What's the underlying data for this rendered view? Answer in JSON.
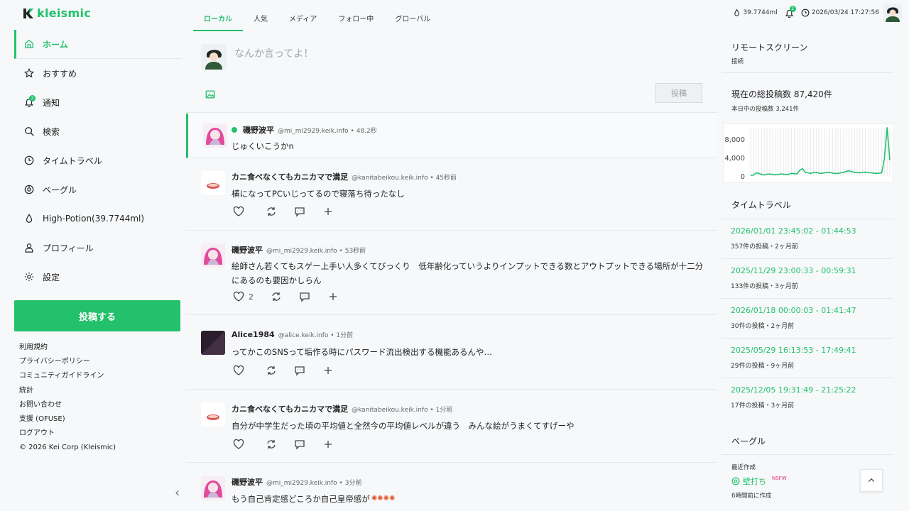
{
  "brand": {
    "logo_mark": "K",
    "name": "kleismic"
  },
  "sidebar": {
    "items": [
      {
        "label": "ホーム"
      },
      {
        "label": "おすすめ"
      },
      {
        "label": "通知",
        "badge": "2"
      },
      {
        "label": "検索"
      },
      {
        "label": "タイムトラベル"
      },
      {
        "label": "ベーグル"
      },
      {
        "label": "High-Potion(39.7744ml)"
      },
      {
        "label": "プロフィール"
      },
      {
        "label": "設定"
      }
    ],
    "post_button": "投稿する",
    "links": [
      "利用規約",
      "プライバシーポリシー",
      "コミュニティガイドライン",
      "統計",
      "お問い合わせ",
      "支援 (OFUSE)",
      "ログアウト",
      "© 2026 Kei Corp (Kleismic)"
    ]
  },
  "tabs": [
    "ローカル",
    "人気",
    "メディア",
    "フォロー中",
    "グローバル"
  ],
  "composer": {
    "placeholder": "なんか言ってよ！",
    "submit": "投稿"
  },
  "posts": [
    {
      "name": "磯野波平",
      "handle": "@mi_mi2929.keik.info • 48.2秒",
      "text": "じゅくいこうかn",
      "online": true
    },
    {
      "name": "カニ食べなくてもカニカマで満足",
      "handle": "@kanitabeikou.keik.info • 45秒前",
      "text": "横になってPCいじってるので寝落ち待ったなし",
      "likes": ""
    },
    {
      "name": "磯野波平",
      "handle": "@mi_mi2929.keik.info • 53秒前",
      "text": "絵師さん若くてもスゲー上手い人多くてびっくり　低年齢化っていうよりインプットできる数とアウトプットできる場所が十二分にあるのも要因かしらん",
      "likes": "2"
    },
    {
      "name": "Alice1984",
      "handle": "@alice.keik.info • 1分前",
      "text": "ってかこのSNSって垢作る時にパスワード流出検出する機能あるんや…",
      "likes": ""
    },
    {
      "name": "カニ食べなくてもカニカマで満足",
      "handle": "@kanitabeikou.keik.info • 1分前",
      "text": "自分が中学生だった頃の平均値と全然今の平均値レベルが違う　みんな絵がうまくてすげーや",
      "likes": ""
    },
    {
      "name": "磯野波平",
      "handle": "@mi_mi2929.keik.info • 3分前",
      "text": "もう自己肯定感どころか自己皇帝感が"
    }
  ],
  "topbar": {
    "potion": "39.7744ml",
    "notif_badge": "2",
    "datetime": "2026/03/24 17:27:56"
  },
  "right": {
    "remote": {
      "title": "リモートスクリーン",
      "status": "接続"
    },
    "stats": {
      "title": "現在の総投稿数 87,420件",
      "today": "本日中の投稿数 3,241件"
    },
    "chart_data": {
      "type": "line",
      "yticks": [
        "8,000",
        "4,000",
        "0"
      ],
      "ylim": [
        0,
        9000
      ],
      "values": [
        120,
        150,
        600,
        500,
        300,
        200,
        350,
        380,
        300,
        250,
        280,
        400,
        350,
        300,
        320,
        500,
        450,
        380,
        1100,
        1400,
        700,
        600,
        500,
        650,
        700,
        550,
        500,
        600,
        650,
        700,
        550,
        500,
        480,
        600,
        650,
        900,
        1000,
        800,
        700,
        650,
        600,
        700,
        750,
        680,
        600,
        550,
        500,
        520,
        600,
        3200,
        9200,
        3000
      ]
    },
    "timetravel": {
      "title": "タイムトラベル",
      "items": [
        {
          "range": "2026/01/01 23:45:02 - 01:44:53",
          "meta": "357件の投稿・2ヶ月前"
        },
        {
          "range": "2025/11/29 23:00:33 - 00:59:31",
          "meta": "133件の投稿・3ヶ月前"
        },
        {
          "range": "2026/01/18 00:00:03 - 01:41:47",
          "meta": "30件の投稿・2ヶ月前"
        },
        {
          "range": "2025/05/29 16:13:53 - 17:49:41",
          "meta": "29件の投稿・9ヶ月前"
        },
        {
          "range": "2025/12/05 19:31:49 - 21:25:22",
          "meta": "17件の投稿・3ヶ月前"
        }
      ]
    },
    "bagel": {
      "title": "ベーグル",
      "recent": "最近作成",
      "item": "壁打ち",
      "tag": "NSFW",
      "time": "6時間前に作成"
    }
  }
}
